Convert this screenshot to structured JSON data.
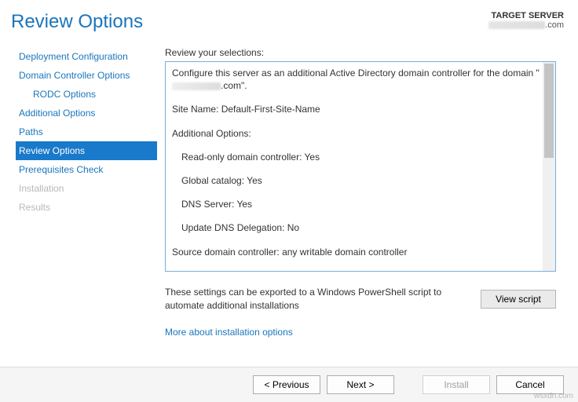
{
  "header": {
    "title": "Review Options",
    "target_label": "TARGET SERVER",
    "target_suffix": ".com"
  },
  "sidebar": {
    "items": [
      {
        "label": "Deployment Configuration",
        "state": "link"
      },
      {
        "label": "Domain Controller Options",
        "state": "link"
      },
      {
        "label": "RODC Options",
        "state": "link-indent"
      },
      {
        "label": "Additional Options",
        "state": "link"
      },
      {
        "label": "Paths",
        "state": "link"
      },
      {
        "label": "Review Options",
        "state": "selected"
      },
      {
        "label": "Prerequisites Check",
        "state": "link"
      },
      {
        "label": "Installation",
        "state": "disabled"
      },
      {
        "label": "Results",
        "state": "disabled"
      }
    ]
  },
  "main": {
    "review_label": "Review your selections:",
    "lines": {
      "config_prefix": "Configure this server as an additional Active Directory domain controller for the domain \"",
      "config_suffix": ".com\".",
      "site": "Site Name: Default-First-Site-Name",
      "addopts": "Additional Options:",
      "rodc": "Read-only domain controller: Yes",
      "gc": "Global catalog: Yes",
      "dns": "DNS Server: Yes",
      "deleg": "Update DNS Delegation: No",
      "src": "Source domain controller: any writable domain controller"
    },
    "export_text": "These settings can be exported to a Windows PowerShell script to automate additional installations",
    "view_script": "View script",
    "more_link": "More about installation options"
  },
  "footer": {
    "prev": "< Previous",
    "next": "Next >",
    "install": "Install",
    "cancel": "Cancel"
  },
  "watermark": "wsxdn.com"
}
